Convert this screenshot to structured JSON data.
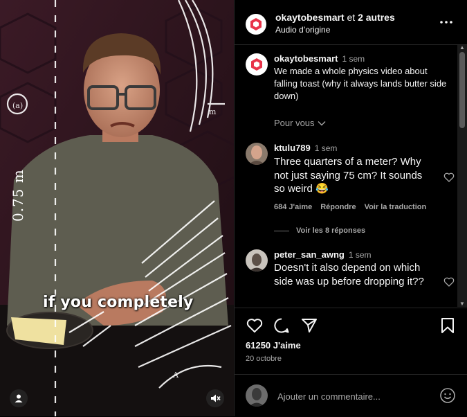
{
  "video": {
    "caption": "if you completely",
    "board_label": "0.75 m"
  },
  "header": {
    "username": "okaytobesmart",
    "and_text": " et ",
    "others": "2 autres",
    "subtitle": "Audio d’origine"
  },
  "post": {
    "username": "okaytobesmart",
    "time": "1 sem",
    "text": "We made a whole physics video about falling toast (why it always lands butter side down)",
    "pour_vous": "Pour vous"
  },
  "comments": [
    {
      "username": "ktulu789",
      "time": "1 sem",
      "text": "Three quarters of a meter? Why not just saying 75 cm? It sounds so weird 😂",
      "likes": "684 J'aime",
      "reply": "Répondre",
      "translate": "Voir la traduction",
      "view_replies": "Voir les 8 réponses"
    },
    {
      "username": "peter_san_awng",
      "time": "1 sem",
      "text": "Doesn't it also depend on which side was up before dropping it??"
    }
  ],
  "stats": {
    "likes": "61250 J'aime",
    "date": "20 octobre"
  },
  "comment_input": {
    "placeholder": "Ajouter un commentaire..."
  },
  "icons": {
    "more": "more-horizontal-icon",
    "heart": "heart-icon",
    "comment": "comment-bubble-icon",
    "share": "send-icon",
    "save": "bookmark-icon",
    "emoji": "emoji-smile-icon",
    "user": "user-icon",
    "mute": "speaker-muted-icon"
  },
  "colors": {
    "background": "#000000",
    "text": "#f5f5f5",
    "secondary": "#a8a8a8",
    "brand_hex": "#e8344a",
    "divider": "#262626"
  }
}
